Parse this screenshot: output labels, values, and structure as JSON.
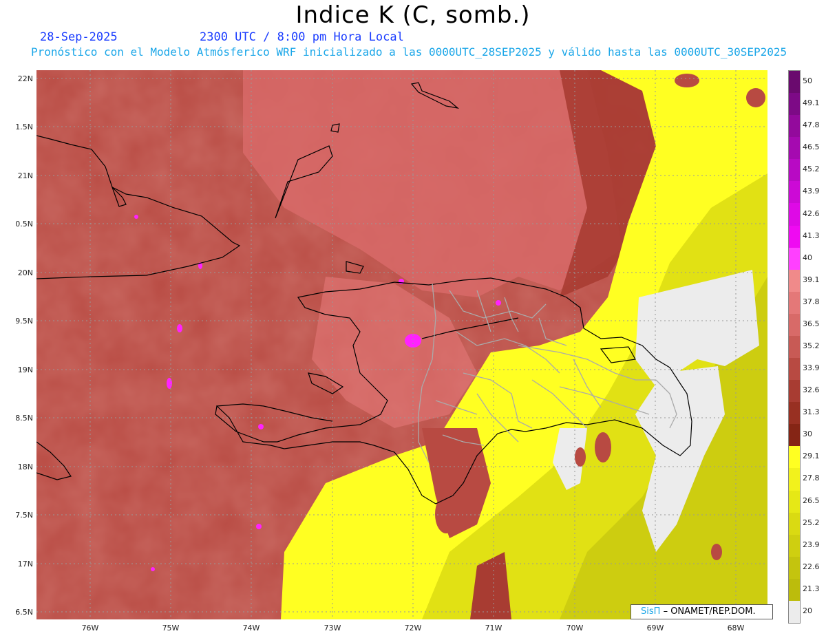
{
  "header": {
    "title": "Indice K (C, somb.)",
    "date": "28-Sep-2025",
    "time": "2300 UTC / 8:00 pm Hora Local",
    "subtitle": "Pronóstico con el Modelo Atmósferico WRF inicializado a las 0000UTC_28SEP2025 y válido hasta las  0000UTC_30SEP2025"
  },
  "axes": {
    "lat_labels": [
      "22N",
      "1.5N",
      "21N",
      "0.5N",
      "20N",
      "9.5N",
      "19N",
      "8.5N",
      "18N",
      "7.5N",
      "17N",
      "6.5N"
    ],
    "lon_labels": [
      "76W",
      "75W",
      "74W",
      "73W",
      "72W",
      "71W",
      "70W",
      "69W",
      "68W"
    ]
  },
  "colorbar": {
    "labels": [
      "50",
      "49.1",
      "47.8",
      "46.5",
      "45.2",
      "43.9",
      "42.6",
      "41.3",
      "40",
      "39.1",
      "37.8",
      "36.5",
      "35.2",
      "33.9",
      "32.6",
      "31.3",
      "30",
      "29.1",
      "27.8",
      "26.5",
      "25.2",
      "23.9",
      "22.6",
      "21.3",
      "20"
    ],
    "colors": [
      "#6a0a6e",
      "#7d0a86",
      "#930a9c",
      "#a50ab0",
      "#b80ac4",
      "#cc0ad6",
      "#de0ae6",
      "#ef0af2",
      "#ff40ff",
      "#f08a8a",
      "#e47878",
      "#d86a68",
      "#c85a55",
      "#b84a42",
      "#a83c32",
      "#983022",
      "#852515",
      "#ffff22",
      "#f2f21c",
      "#e6e816",
      "#dada12",
      "#cfcf10",
      "#c4c40e",
      "#bcbc0c",
      "#ececec"
    ]
  },
  "credit": {
    "logo": "SisΠ",
    "text": "– ONAMET/REP.DOM."
  }
}
